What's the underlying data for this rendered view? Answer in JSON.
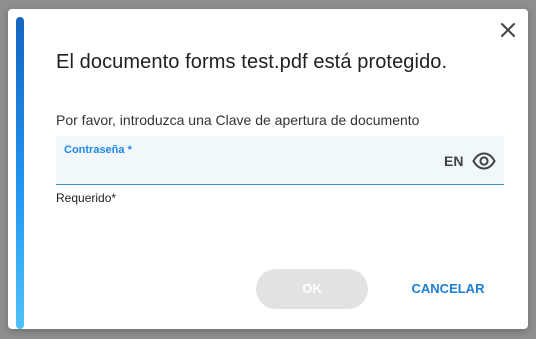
{
  "dialog": {
    "title": "El documento forms test.pdf está protegido.",
    "prompt": "Por favor, introduzca una Clave de apertura de documento",
    "password_field": {
      "label": "Contraseña *",
      "value": "",
      "language": "EN"
    },
    "helper_text": "Requerido*",
    "ok_label": "OK",
    "cancel_label": "CANCELAR",
    "icons": {
      "close": "close-icon",
      "visibility": "eye-icon"
    },
    "colors": {
      "accent": "#1e88e5",
      "ok_disabled_bg": "#e2e2e2",
      "field_bg": "#f1f8fc"
    }
  }
}
